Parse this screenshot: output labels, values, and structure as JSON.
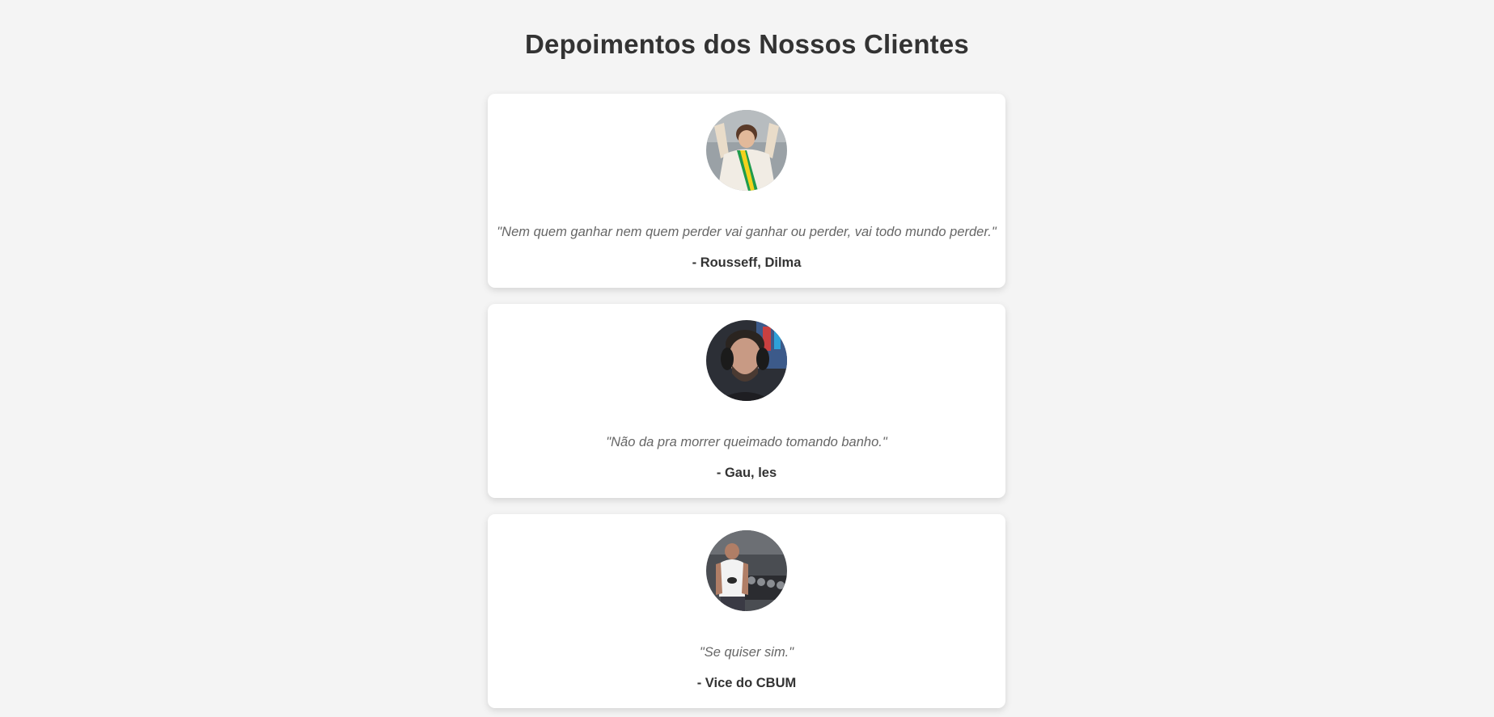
{
  "page": {
    "title": "Depoimentos dos Nossos Clientes"
  },
  "testimonials": [
    {
      "quote": "\"Nem quem ganhar nem quem perder vai ganhar ou perder, vai todo mundo perder.\"",
      "author": "- Rousseff, Dilma"
    },
    {
      "quote": "\"Não da pra morrer queimado tomando banho.\"",
      "author": "- Gau, les"
    },
    {
      "quote": "\"Se quiser sim.\"",
      "author": "- Vice do CBUM"
    }
  ],
  "colors": {
    "background": "#f4f4f4",
    "card": "#ffffff",
    "title": "#333333",
    "quote": "#666666",
    "author": "#333333"
  }
}
